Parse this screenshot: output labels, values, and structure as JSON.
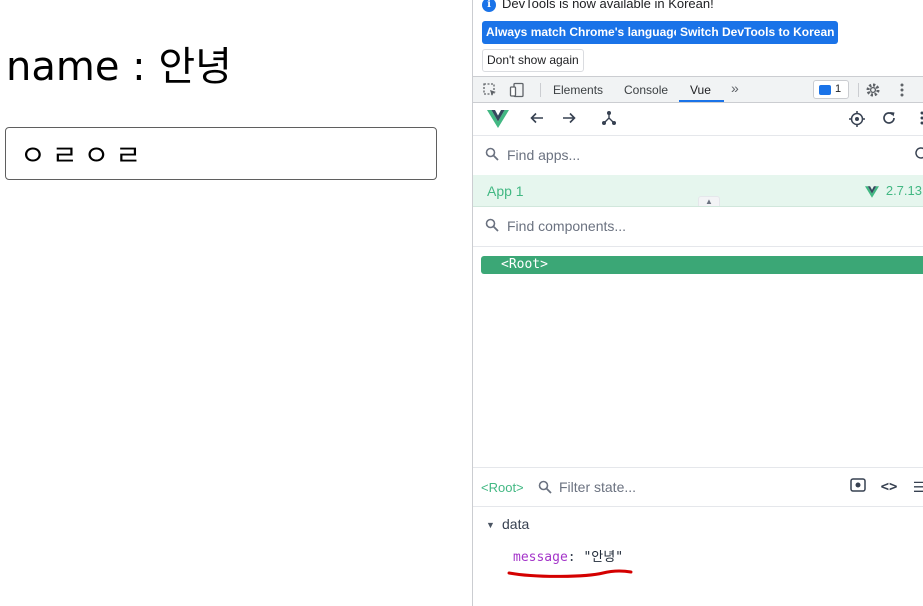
{
  "page": {
    "name_label": "name",
    "separator": ":",
    "name_value": "안녕",
    "input_value": "ㅇㄹㅇㄹ"
  },
  "devtools": {
    "infobar": {
      "message": "DevTools is now available in Korean!",
      "match_language_button": "Always match Chrome's language",
      "switch_button": "Switch DevTools to Korean",
      "dismiss_button": "Don't show again"
    },
    "tabs": [
      {
        "label": "Elements"
      },
      {
        "label": "Console"
      },
      {
        "label": "Vue"
      }
    ],
    "active_tab": "Vue",
    "issues_count": "1",
    "accent_color": "#1a73e8"
  },
  "vue": {
    "brand_color": "#42b883",
    "find_apps_placeholder": "Find apps...",
    "app_name": "App 1",
    "vue_version": "2.7.13",
    "find_components_placeholder": "Find components...",
    "root_component": "<Root>",
    "selected_component": "<Root>",
    "filter_state_placeholder": "Filter state...",
    "data_section_title": "data",
    "data": [
      {
        "key": "message",
        "value": "\"안녕\""
      }
    ]
  }
}
